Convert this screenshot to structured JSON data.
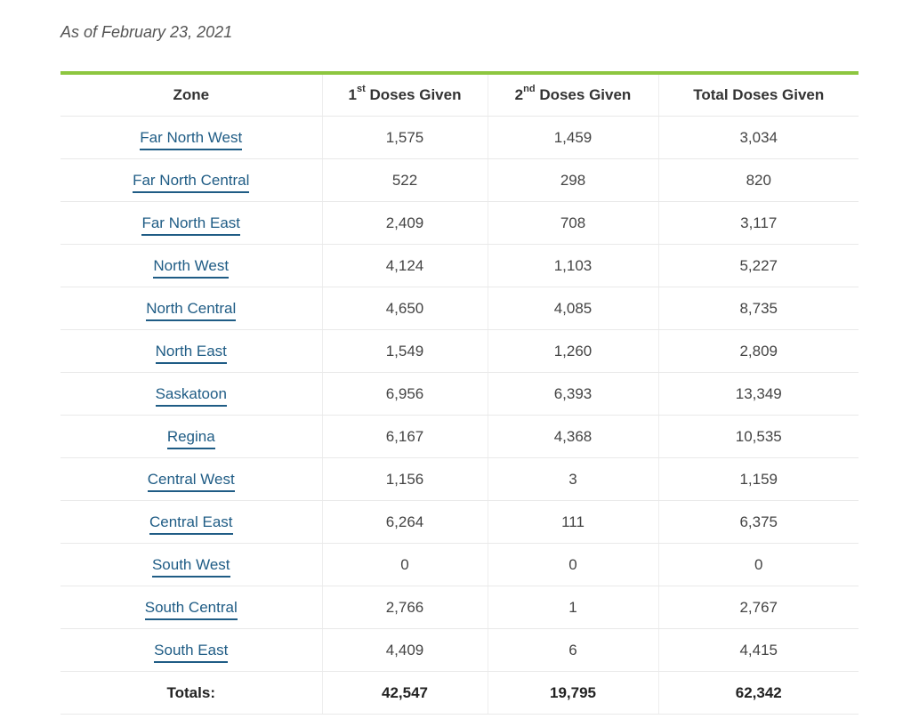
{
  "as_of": "As of February 23, 2021",
  "header": {
    "zone": "Zone",
    "first_sup": "st",
    "first_num": "1",
    "first_rest": " Doses Given",
    "second_num": "2",
    "second_sup": "nd",
    "second_rest": " Doses Given",
    "total": "Total Doses Given"
  },
  "rows": [
    {
      "zone": "Far North West",
      "first": "1,575",
      "second": "1,459",
      "total": "3,034"
    },
    {
      "zone": "Far North Central",
      "first": "522",
      "second": "298",
      "total": "820"
    },
    {
      "zone": "Far North East",
      "first": "2,409",
      "second": "708",
      "total": "3,117"
    },
    {
      "zone": "North West",
      "first": "4,124",
      "second": "1,103",
      "total": "5,227"
    },
    {
      "zone": "North Central",
      "first": "4,650",
      "second": "4,085",
      "total": "8,735"
    },
    {
      "zone": "North East",
      "first": "1,549",
      "second": "1,260",
      "total": "2,809"
    },
    {
      "zone": "Saskatoon",
      "first": "6,956",
      "second": "6,393",
      "total": "13,349"
    },
    {
      "zone": "Regina",
      "first": "6,167",
      "second": "4,368",
      "total": "10,535"
    },
    {
      "zone": "Central West",
      "first": "1,156",
      "second": "3",
      "total": "1,159"
    },
    {
      "zone": "Central East",
      "first": "6,264",
      "second": "111",
      "total": "6,375"
    },
    {
      "zone": "South West",
      "first": "0",
      "second": "0",
      "total": "0"
    },
    {
      "zone": "South Central",
      "first": "2,766",
      "second": "1",
      "total": "2,767"
    },
    {
      "zone": "South East",
      "first": "4,409",
      "second": "6",
      "total": "4,415"
    }
  ],
  "totals": {
    "label": "Totals:",
    "first": "42,547",
    "second": "19,795",
    "total": "62,342"
  },
  "colors": {
    "accent_rule": "#8dc63f",
    "link": "#1f5c85"
  }
}
